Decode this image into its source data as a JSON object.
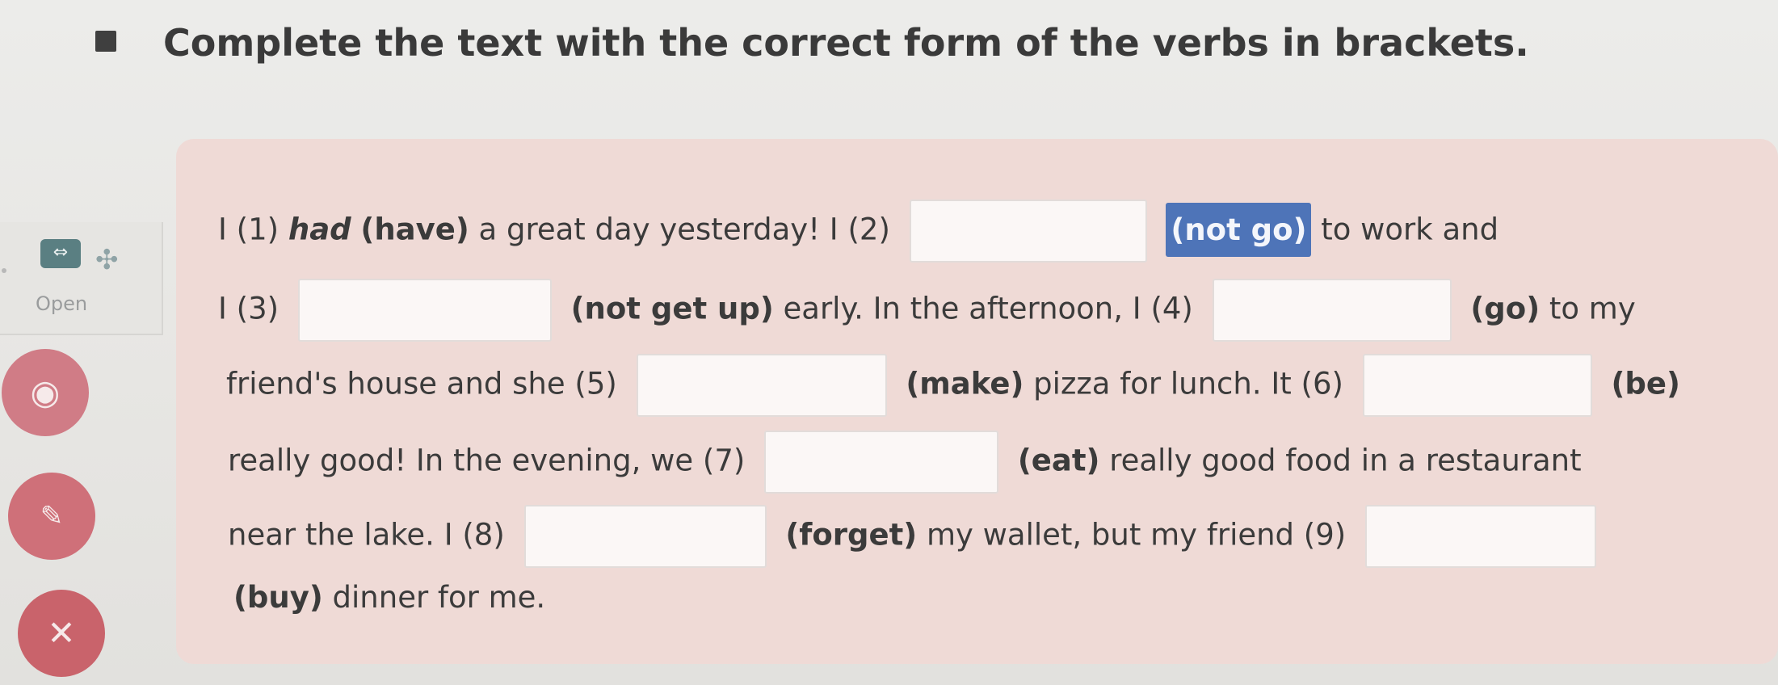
{
  "instruction": "Complete the text with the correct form of the verbs in brackets.",
  "side_panel": {
    "open_label": "Open",
    "open_icon": "expand-icon",
    "move_icon": "move-arrows-icon"
  },
  "buttons": [
    {
      "name": "eye-icon",
      "glyph": "◉"
    },
    {
      "name": "paint-icon",
      "glyph": "✎"
    },
    {
      "name": "close-icon",
      "glyph": "✕"
    }
  ],
  "exercise": {
    "n1": "I (1)",
    "a1": "had",
    "v1": "(have)",
    "t1": "a great day yesterday! I (2)",
    "v2": "(not go)",
    "t2": "to work and",
    "n3": "I (3)",
    "v3": "(not get up)",
    "t3": "early. In  the afternoon, I (4)",
    "v4": "(go)",
    "t4": "to my",
    "t5": "friend's house and she (5)",
    "v5": "(make)",
    "t6": "pizza for lunch. It (6)",
    "v6": "(be)",
    "t7": "really good! In the evening, we (7)",
    "v7": "(eat)",
    "t8": "really good  food in a restaurant",
    "t9": "near the lake. I (8)",
    "v8": "(forget)",
    "t10": "my wallet, but my friend (9)",
    "v9": "(buy)",
    "t11": "dinner for me."
  },
  "colors": {
    "card": "#efdad6",
    "highlight": "#4e74b8",
    "button": "#cf7079"
  }
}
